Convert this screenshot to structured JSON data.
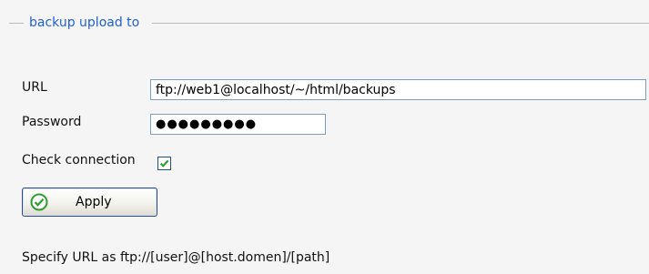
{
  "group": {
    "title": "backup upload to"
  },
  "form": {
    "url": {
      "label": "URL",
      "value": "ftp://web1@localhost/~/html/backups"
    },
    "password": {
      "label": "Password",
      "masked_value": "●●●●●●●●●"
    },
    "check_connection": {
      "label": "Check connection",
      "checked": true
    },
    "apply_label": "Apply"
  },
  "hint": "Specify URL as ftp://[user]@[host.domen]/[path]",
  "colors": {
    "group_title": "#1f5fd6",
    "field_border": "#7f9db9",
    "check_mark": "#21a121",
    "apply_icon": "#2e9f2e"
  },
  "icons": {
    "checkbox": "check-icon",
    "apply": "check-circle-icon"
  }
}
